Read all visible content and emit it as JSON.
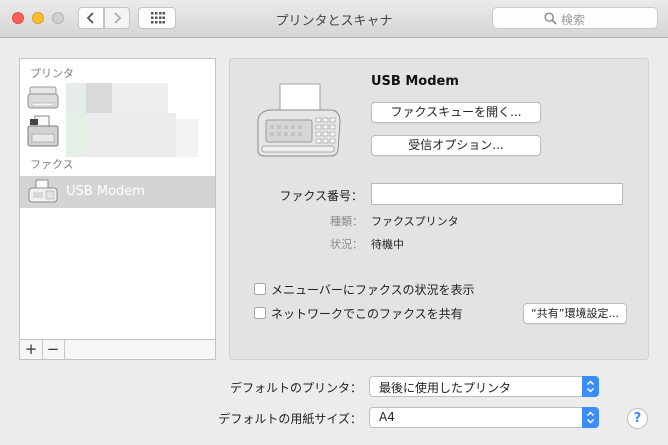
{
  "window": {
    "title": "プリンタとスキャナ"
  },
  "toolbar": {
    "search_placeholder": "検索"
  },
  "sidebar": {
    "printers_label": "プリンタ",
    "fax_label": "ファクス",
    "fax_items": [
      {
        "label": "USB Modem"
      }
    ],
    "add_label": "+",
    "remove_label": "−"
  },
  "device": {
    "name": "USB Modem",
    "open_queue_label": "ファクスキューを開く...",
    "receive_options_label": "受信オプション...",
    "fax_number_label": "ファクス番号：",
    "fax_number_value": "",
    "kind_label": "種類：",
    "kind_value": "ファクスプリンタ",
    "status_label": "状況：",
    "status_value": "待機中",
    "show_menubar_label": "メニューバーにファクスの状況を表示",
    "show_menubar_checked": false,
    "share_label": "ネットワークでこのファクスを共有",
    "share_checked": false,
    "sharing_prefs_label": "“共有”環境設定..."
  },
  "defaults": {
    "default_printer_label": "デフォルトのプリンタ：",
    "default_printer_value": "最後に使用したプリンタ",
    "default_paper_label": "デフォルトの用紙サイズ：",
    "default_paper_value": "A4"
  },
  "help_label": "?",
  "colors": {
    "accent": "#3b8df7",
    "selection": "#d4d4d4"
  }
}
